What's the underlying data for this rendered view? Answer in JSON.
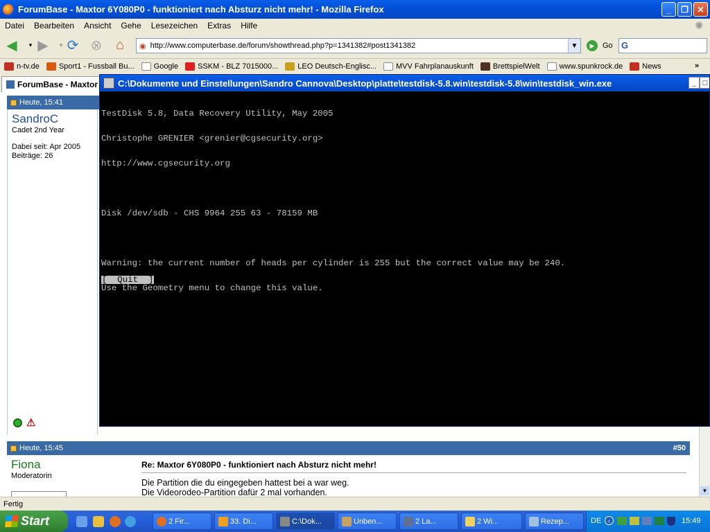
{
  "firefox": {
    "title": "ForumBase - Maxtor 6Y080P0 - funktioniert nach Absturz nicht mehr! - Mozilla Firefox",
    "menu": [
      "Datei",
      "Bearbeiten",
      "Ansicht",
      "Gehe",
      "Lesezeichen",
      "Extras",
      "Hilfe"
    ],
    "url": "http://www.computerbase.de/forum/showthread.php?p=1341382#post1341382",
    "go_label": "Go",
    "bookmarks": [
      "n-tv.de",
      "Sport1 - Fussball Bu...",
      "Google",
      "SSKM - BLZ 7015000...",
      "LEO Deutsch-Englisc...",
      "MVV Fahrplanauskunft",
      "BrettspielWelt",
      "www.spunkrock.de",
      "News"
    ],
    "tab_label": "ForumBase - Maxtor",
    "status": "Fertig"
  },
  "forum": {
    "post1": {
      "time": "Heute, 15:41",
      "user": "SandroC",
      "role": "Cadet 2nd Year",
      "joined": "Dabei seit: Apr 2005",
      "posts": "Beiträge: 26"
    },
    "post2": {
      "time": "Heute, 15:45",
      "number": "#50",
      "user": "Fiona",
      "role": "Moderatorin",
      "subject": "Re: Maxtor 6Y080P0 - funktioniert nach Absturz nicht mehr!",
      "lines": [
        "Die Partition die du eingegeben hattest bei a war weg.",
        "Die Videorodeo-Partition dafür 2 mal vorhanden."
      ]
    }
  },
  "console": {
    "title": "C:\\Dokumente und Einstellungen\\Sandro Cannova\\Desktop\\platte\\testdisk-5.8.win\\testdisk-5.8\\win\\testdisk_win.exe",
    "lines": [
      "TestDisk 5.8, Data Recovery Utility, May 2005",
      "Christophe GRENIER <grenier@cgsecurity.org>",
      "http://www.cgsecurity.org",
      "",
      "Disk /dev/sdb - CHS 9964 255 63 - 78159 MB",
      "",
      "Warning: the current number of heads per cylinder is 255 but the correct value may be 240.",
      "Use the Geometry menu to change this value."
    ],
    "quit": "[  Quit  ]"
  },
  "taskbar": {
    "start": "Start",
    "tasks": [
      "2 Fir...",
      "33. Di...",
      "C:\\Dok...",
      "Unben...",
      "2 La...",
      "2 Wi...",
      "Rezep..."
    ],
    "lang": "DE",
    "clock": "15:49"
  }
}
